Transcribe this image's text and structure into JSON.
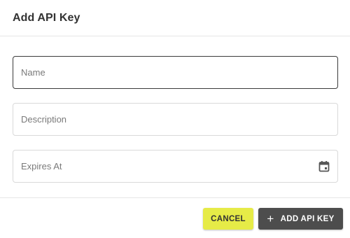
{
  "dialog": {
    "title": "Add API Key"
  },
  "form": {
    "name": {
      "placeholder": "Name",
      "value": ""
    },
    "description": {
      "placeholder": "Description",
      "value": ""
    },
    "expires_at": {
      "placeholder": "Expires At",
      "value": "",
      "icon": "calendar-icon"
    }
  },
  "footer": {
    "cancel_label": "CANCEL",
    "add_label": "ADD API KEY",
    "add_icon": "plus-icon"
  },
  "colors": {
    "cancel_bg": "#e6eb47",
    "add_bg": "#4d4d4d",
    "focused_border": "#3b3b3b"
  }
}
